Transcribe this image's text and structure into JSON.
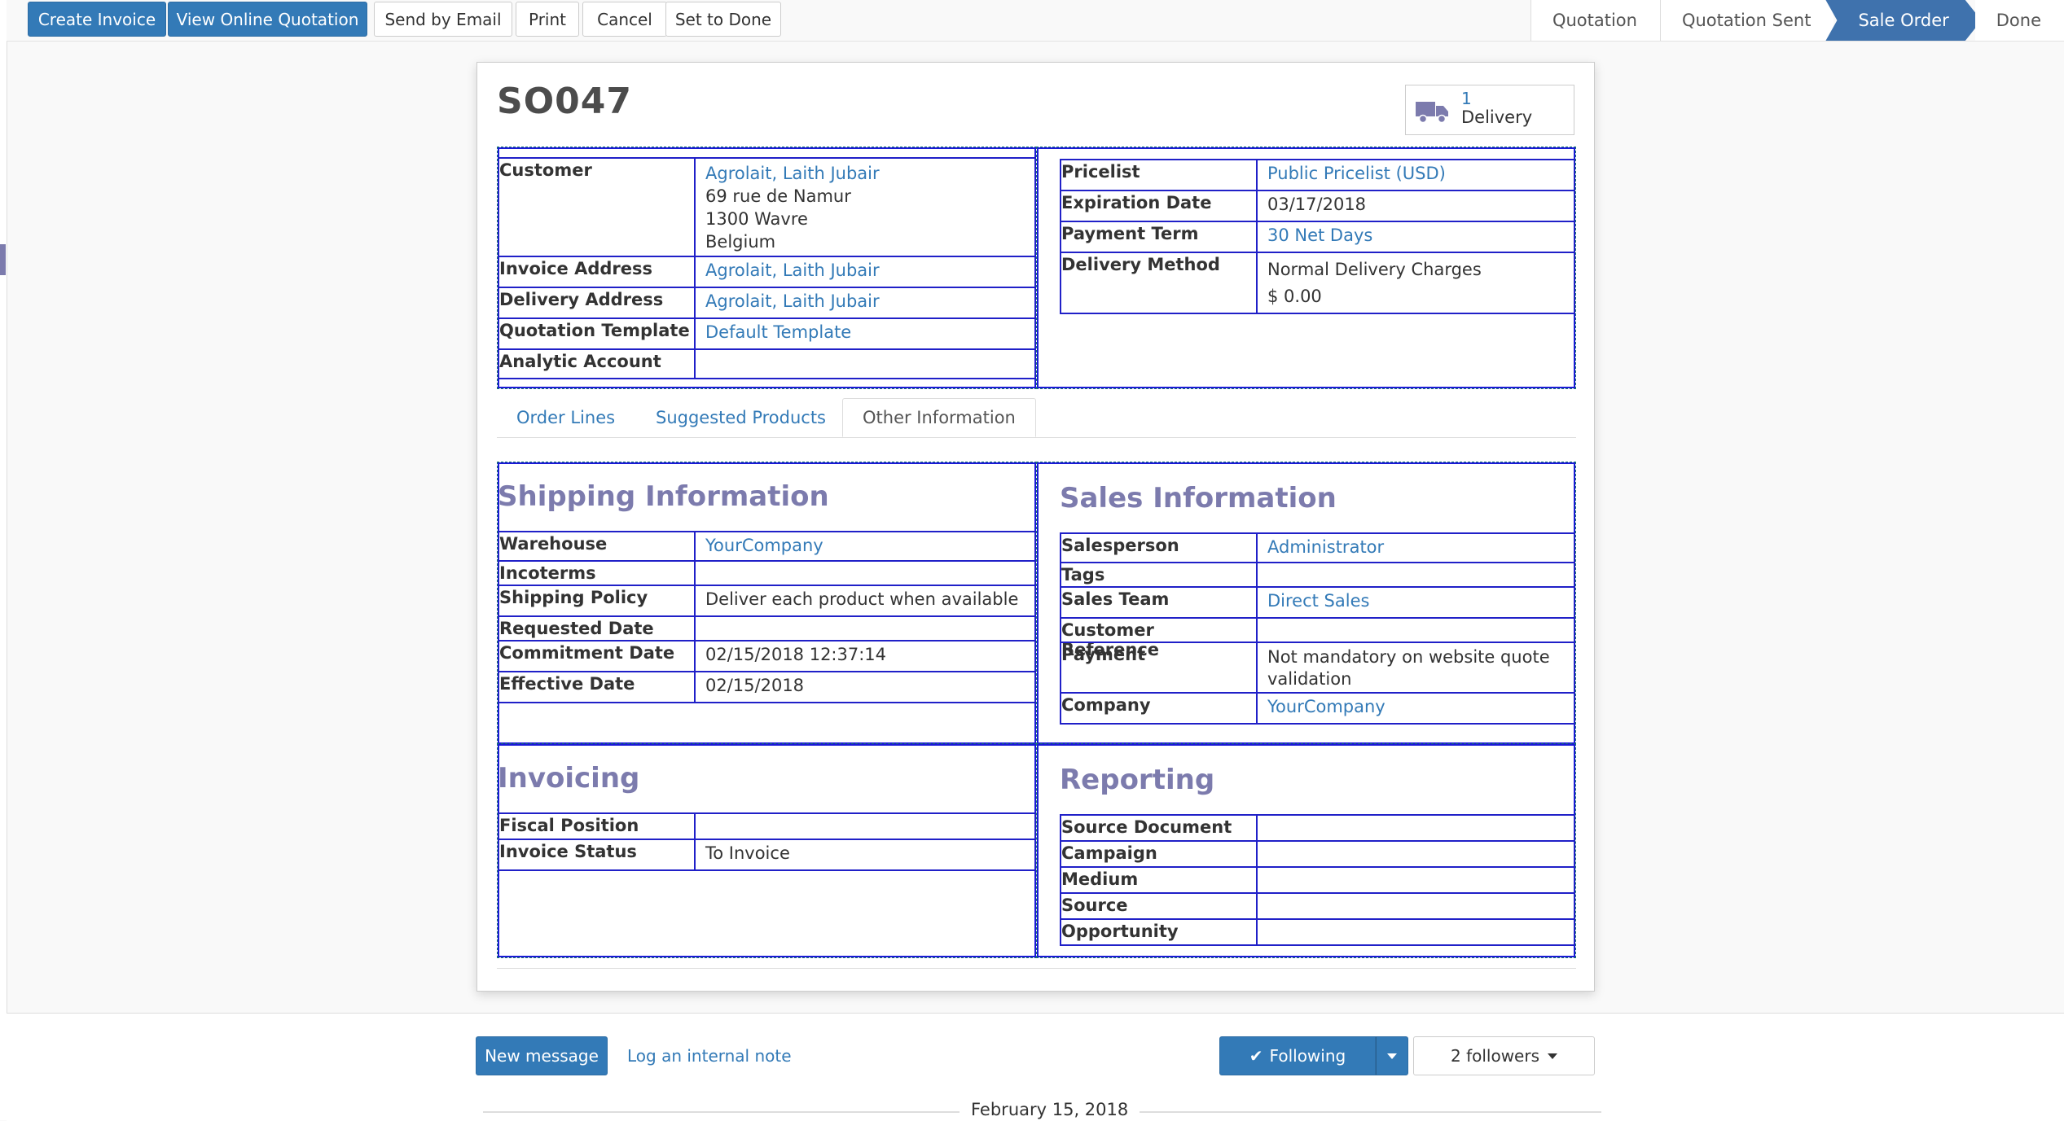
{
  "toolbar": {
    "create_invoice": "Create Invoice",
    "view_online": "View Online Quotation",
    "send_email": "Send by Email",
    "print": "Print",
    "cancel": "Cancel",
    "set_done": "Set to Done"
  },
  "statusbar": {
    "stages": [
      "Quotation",
      "Quotation Sent",
      "Sale Order",
      "Done"
    ],
    "active": "Sale Order"
  },
  "record": {
    "name": "SO047",
    "delivery_count": "1",
    "delivery_label": "Delivery"
  },
  "header_left": {
    "customer_label": "Customer",
    "customer_name": "Agrolait, Laith Jubair",
    "customer_addr1": "69 rue de Namur",
    "customer_addr2": "1300 Wavre",
    "customer_addr3": "Belgium",
    "invoice_address_label": "Invoice Address",
    "invoice_address": "Agrolait, Laith Jubair",
    "delivery_address_label": "Delivery Address",
    "delivery_address": "Agrolait, Laith Jubair",
    "quotation_template_label": "Quotation Template",
    "quotation_template": "Default Template",
    "analytic_account_label": "Analytic Account",
    "analytic_account": ""
  },
  "header_right": {
    "pricelist_label": "Pricelist",
    "pricelist": "Public Pricelist (USD)",
    "expiration_label": "Expiration Date",
    "expiration": "03/17/2018",
    "payment_term_label": "Payment Term",
    "payment_term": "30 Net Days",
    "delivery_method_label": "Delivery Method",
    "delivery_method": "Normal Delivery Charges",
    "delivery_price": "$ 0.00"
  },
  "tabs": [
    "Order Lines",
    "Suggested Products",
    "Other Information"
  ],
  "shipping": {
    "title": "Shipping Information",
    "warehouse_label": "Warehouse",
    "warehouse": "YourCompany",
    "incoterms_label": "Incoterms",
    "incoterms": "",
    "policy_label": "Shipping Policy",
    "policy": "Deliver each product when available",
    "requested_label": "Requested Date",
    "requested": "",
    "commitment_label": "Commitment Date",
    "commitment": "02/15/2018 12:37:14",
    "effective_label": "Effective Date",
    "effective": "02/15/2018"
  },
  "sales": {
    "title": "Sales Information",
    "salesperson_label": "Salesperson",
    "salesperson": "Administrator",
    "tags_label": "Tags",
    "tags": "",
    "team_label": "Sales Team",
    "team": "Direct Sales",
    "customer_ref_label": "Customer Reference",
    "customer_ref": "",
    "payment_label": "Payment",
    "payment": "Not mandatory on website quote validation",
    "company_label": "Company",
    "company": "YourCompany"
  },
  "invoicing": {
    "title": "Invoicing",
    "fiscal_label": "Fiscal Position",
    "fiscal": "",
    "status_label": "Invoice Status",
    "status": "To Invoice"
  },
  "reporting": {
    "title": "Reporting",
    "source_doc_label": "Source Document",
    "campaign_label": "Campaign",
    "medium_label": "Medium",
    "source_label": "Source",
    "opportunity_label": "Opportunity"
  },
  "chatter": {
    "new_message": "New message",
    "log_note": "Log an internal note",
    "following": "Following",
    "followers": "2 followers",
    "date": "February 15, 2018"
  },
  "colors": {
    "primary": "#337ab7",
    "section_heading": "#7c7bad",
    "active_stage": "#3f72ad"
  }
}
